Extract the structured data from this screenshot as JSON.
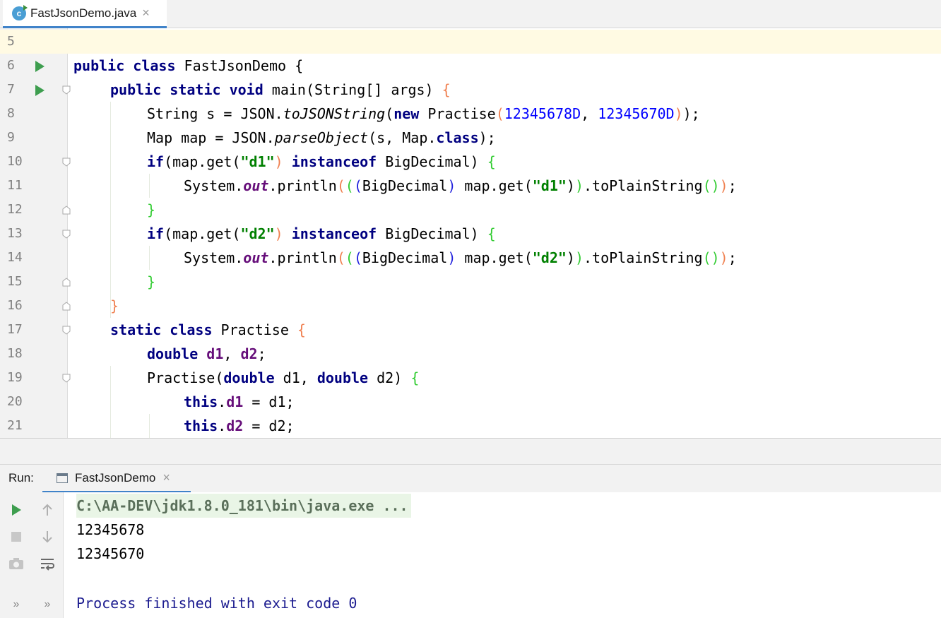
{
  "editor_tab": {
    "label": "FastJsonDemo.java",
    "close": "×",
    "icon": "java-class-icon"
  },
  "gutter": {
    "lines": [
      "5",
      "6",
      "7",
      "8",
      "9",
      "10",
      "11",
      "12",
      "13",
      "14",
      "15",
      "16",
      "17",
      "18",
      "19",
      "20",
      "21"
    ]
  },
  "code": {
    "l5": "",
    "l6": {
      "kw1": "public class",
      "rest": " FastJsonDemo {"
    },
    "l7": {
      "kw1": "public static void",
      "rest": " main(String[] args) ",
      "brace": "{"
    },
    "l8": {
      "a": "String s = JSON.",
      "method": "toJSONString",
      "b": "(",
      "kw": "new",
      "c": " Practise",
      "p1": "(",
      "n1": "12345678D",
      "comma": ", ",
      "n2": "12345670D",
      "p2": ")",
      "end": ");"
    },
    "l9": {
      "a": "Map map = JSON.",
      "method": "parseObject",
      "b": "(s, Map.",
      "kw": "class",
      "end": ");"
    },
    "l10": {
      "kw": "if",
      "a": "(map.get(",
      "s": "\"d1\"",
      "b": ") ",
      "kw2": "instanceof",
      "c": " BigDecimal) ",
      "brace": "{"
    },
    "l11": {
      "a": "System.",
      "out": "out",
      "b": ".println",
      "p1": "(",
      "p2": "(",
      "p3": "(",
      "c": "BigDecimal",
      "p4": ")",
      "d": " map.get(",
      "s": "\"d1\"",
      "e": ")",
      "p5": ")",
      "f": ".toPlainString",
      "p6": "()",
      "p7": ")",
      "end": ";"
    },
    "l12": {
      "brace": "}"
    },
    "l13": {
      "kw": "if",
      "a": "(map.get(",
      "s": "\"d2\"",
      "b": ") ",
      "kw2": "instanceof",
      "c": " BigDecimal) ",
      "brace": "{"
    },
    "l14": {
      "a": "System.",
      "out": "out",
      "b": ".println",
      "p1": "(",
      "p2": "(",
      "p3": "(",
      "c": "BigDecimal",
      "p4": ")",
      "d": " map.get(",
      "s": "\"d2\"",
      "e": ")",
      "p5": ")",
      "f": ".toPlainString",
      "p6": "()",
      "p7": ")",
      "end": ";"
    },
    "l15": {
      "brace": "}"
    },
    "l16": {
      "brace": "}"
    },
    "l17": {
      "kw": "static class",
      "rest": " Practise ",
      "brace": "{"
    },
    "l18": {
      "kw": "double",
      "sp": " ",
      "f1": "d1",
      "c": ", ",
      "f2": "d2",
      "end": ";"
    },
    "l19": {
      "a": "Practise(",
      "kw1": "double",
      "b": " d1, ",
      "kw2": "double",
      "c": " d2) ",
      "brace": "{"
    },
    "l20": {
      "kw": "this",
      "dot": ".",
      "f": "d1",
      "rest": " = d1;"
    },
    "l21": {
      "kw": "this",
      "dot": ".",
      "f": "d2",
      "rest": " = d2;"
    }
  },
  "run_panel": {
    "label": "Run:",
    "tab_label": "FastJsonDemo",
    "tab_close": "×",
    "console_lines": [
      "C:\\AA-DEV\\jdk1.8.0_181\\bin\\java.exe ...",
      "12345678",
      "12345670",
      "",
      "Process finished with exit code 0"
    ],
    "toolbar_more": "»"
  },
  "colors": {
    "keyword": "#000080",
    "number": "#0000ff",
    "string": "#008000",
    "field": "#660e7a",
    "accent_tab": "#4083c9",
    "run_green": "#3e9e4f"
  }
}
